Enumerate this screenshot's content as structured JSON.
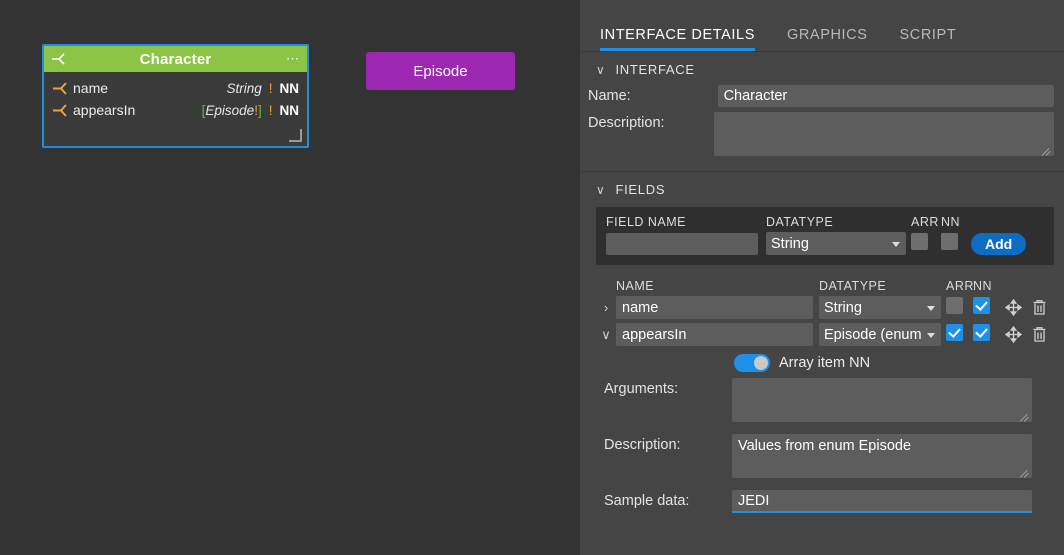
{
  "canvas": {
    "character_node": {
      "title": "Character",
      "menu_glyph": "⋯",
      "fields": [
        {
          "name": "name",
          "type": "String",
          "type_prefix": "",
          "type_suffix": "",
          "inner_bang": "",
          "bang": "!",
          "nn": "NN"
        },
        {
          "name": "appearsIn",
          "type": "Episode",
          "type_prefix": "[",
          "type_suffix": "]",
          "inner_bang": "!",
          "bang": "!",
          "nn": "NN"
        }
      ]
    },
    "episode_node": {
      "title": "Episode"
    }
  },
  "panel": {
    "tabs": [
      {
        "label": "INTERFACE DETAILS",
        "active": true
      },
      {
        "label": "GRAPHICS",
        "active": false
      },
      {
        "label": "SCRIPT",
        "active": false
      }
    ],
    "interface": {
      "section_title": "INTERFACE",
      "chevron": "∨",
      "name_label": "Name:",
      "name_value": "Character",
      "description_label": "Description:",
      "description_value": ""
    },
    "fields": {
      "section_title": "FIELDS",
      "chevron": "∨",
      "add_row": {
        "field_name_header": "FIELD NAME",
        "datatype_header": "DATATYPE",
        "arr_header": "ARR",
        "nn_header": "NN",
        "field_name_value": "",
        "datatype_value": "String",
        "arr_checked": false,
        "nn_checked": false,
        "add_label": "Add"
      },
      "table": {
        "headers": {
          "name": "NAME",
          "datatype": "DATATYPE",
          "arr": "ARR",
          "nn": "NN"
        },
        "rows": [
          {
            "expander": "›",
            "expanded": false,
            "name": "name",
            "datatype": "String",
            "arr_checked": false,
            "nn_checked": true,
            "move_icon": "move-icon",
            "delete_icon": "trash-icon"
          },
          {
            "expander": "∨",
            "expanded": true,
            "name": "appearsIn",
            "datatype": "Episode (enum",
            "arr_checked": true,
            "nn_checked": true,
            "move_icon": "move-icon",
            "delete_icon": "trash-icon"
          }
        ]
      },
      "detail": {
        "array_item_nn_label": "Array item NN",
        "array_item_nn_on": true,
        "arguments_label": "Arguments:",
        "arguments_value": "",
        "description_label": "Description:",
        "description_value": "Values from enum Episode",
        "sample_data_label": "Sample data:",
        "sample_data_value": "JEDI"
      }
    }
  },
  "colors": {
    "canvas_bg": "#333333",
    "panel_bg": "#454545",
    "node_header_green": "#8cc445",
    "node_select_blue": "#1e8ee0",
    "episode_purple": "#9c27b0",
    "accent_blue": "#1e90e8",
    "add_button_blue": "#0d6cc4",
    "socket_orange": "#f0a030",
    "bracket_green": "#5dbb46"
  }
}
